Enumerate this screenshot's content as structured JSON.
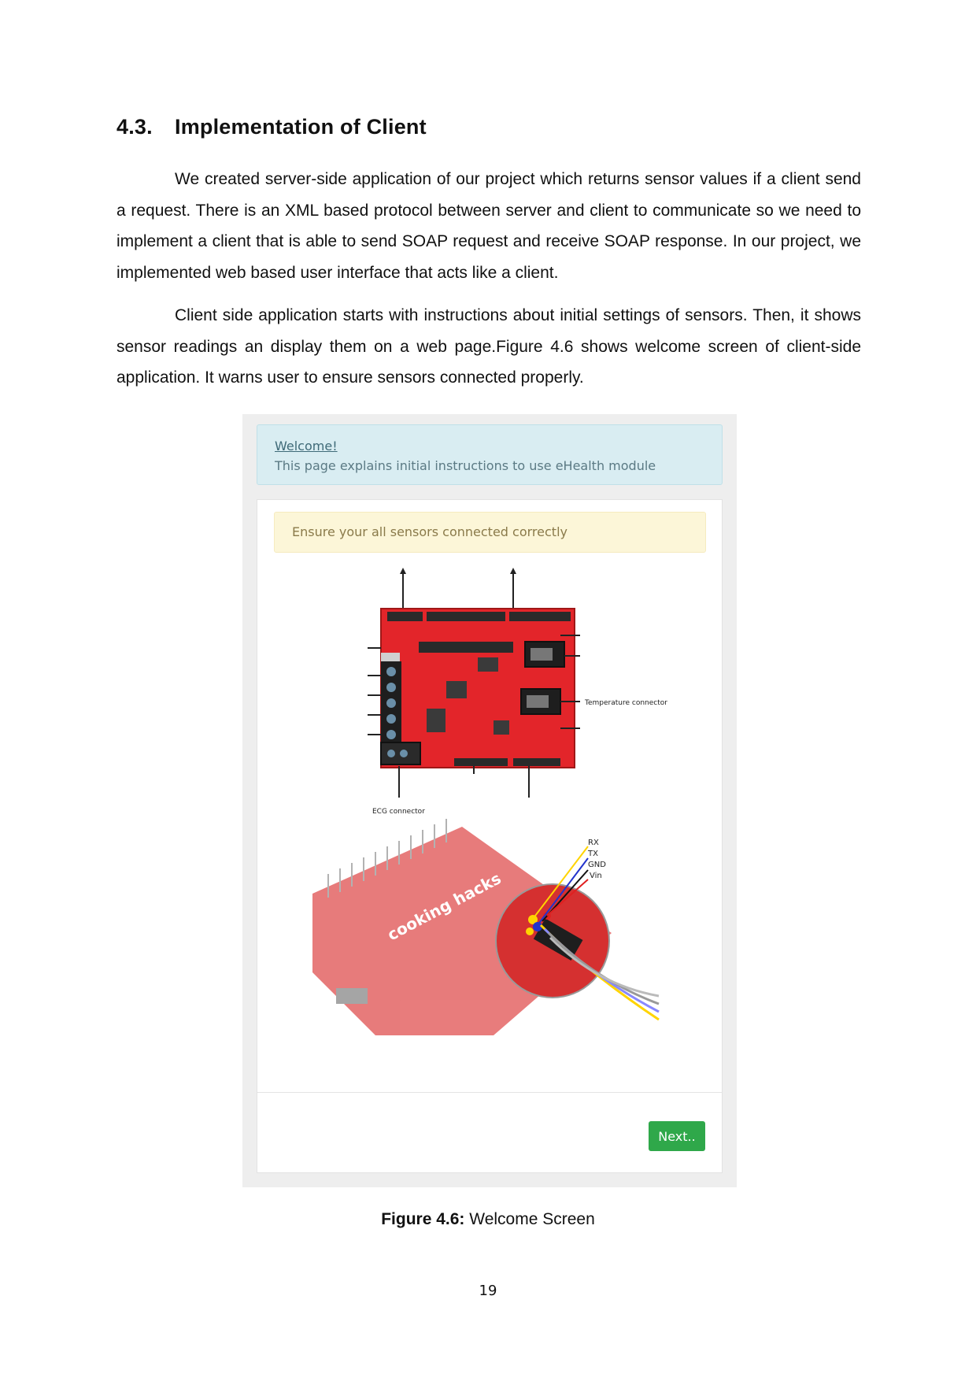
{
  "section": {
    "number": "4.3.",
    "title": "Implementation of Client"
  },
  "paragraphs": [
    "We created server-side application of our project which returns sensor values if a client send a request. There is an XML based protocol between server and client to communicate so we need to implement a client that is able to send SOAP request and receive SOAP response. In our project, we implemented web based user interface that acts like a client.",
    "Client side application starts with instructions about initial settings of sensors. Then, it shows sensor readings an display them on a web page.Figure 4.6 shows welcome screen of client-side application. It warns user to ensure sensors connected properly."
  ],
  "screenshot": {
    "welcome_title": "Welcome!",
    "welcome_subtitle": "This page explains initial instructions to use eHealth module",
    "warning_text": "Ensure your all sensors connected correctly",
    "labels": {
      "temperature": "Temperature connector",
      "ecg": "ECG connector",
      "rx": "RX",
      "tx": "TX",
      "gnd": "GND",
      "vin": "Vin",
      "board_brand": "cooking hacks"
    },
    "next_button": "Next..",
    "colors": {
      "info_bg": "#d9edf2",
      "warning_bg": "#fcf6d8",
      "button_bg": "#2fa84a",
      "board_red": "#e02020"
    }
  },
  "caption": {
    "label": "Figure 4.6:",
    "text": " Welcome Screen"
  },
  "page_number": "19"
}
